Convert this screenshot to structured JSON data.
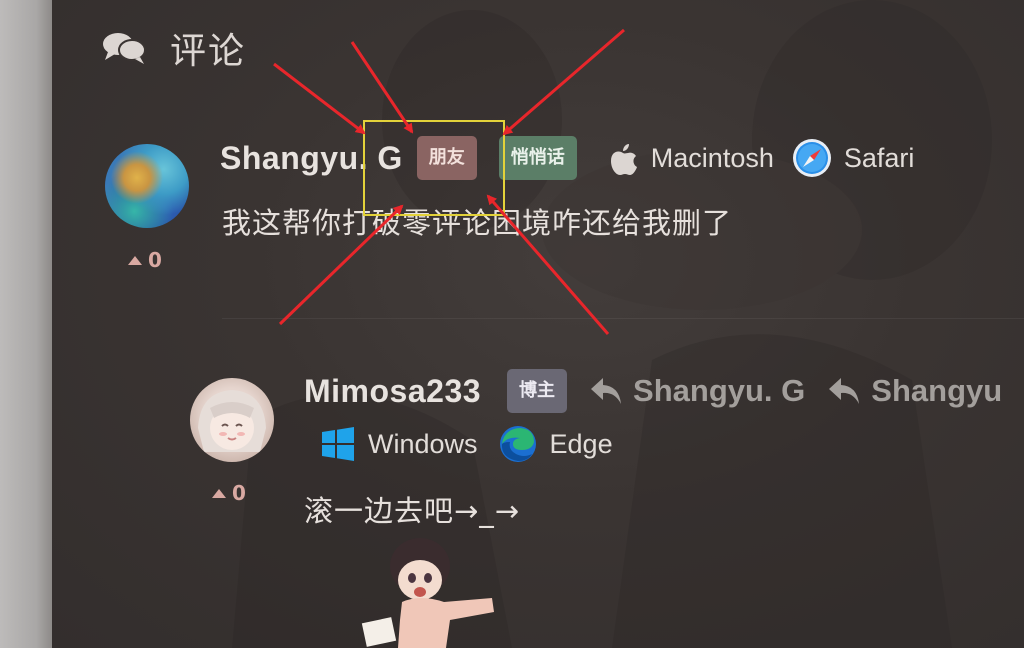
{
  "section": {
    "title": "评论",
    "icon": "comments-icon"
  },
  "comments": [
    {
      "author": "Shangyu. G",
      "badges": [
        "朋友",
        "悄悄话"
      ],
      "os": {
        "name": "Macintosh",
        "icon": "apple-icon"
      },
      "browser": {
        "name": "Safari",
        "icon": "safari-icon"
      },
      "text": "我这帮你打破零评论困境咋还给我删了",
      "votes": "0"
    },
    {
      "author": "Mimosa233",
      "badges": [
        "博主"
      ],
      "reply_to": [
        "Shangyu. G",
        "Shangyu"
      ],
      "os": {
        "name": "Windows",
        "icon": "windows-icon"
      },
      "browser": {
        "name": "Edge",
        "icon": "edge-icon"
      },
      "text": "滚一边去吧→_→",
      "votes": "0"
    }
  ],
  "colors": {
    "badge_friend": "#8a6462",
    "badge_whisper": "#5b7e67",
    "badge_host": "#6a6874",
    "annotation_arrow": "#e8262b",
    "annotation_box": "#e3d23a"
  }
}
